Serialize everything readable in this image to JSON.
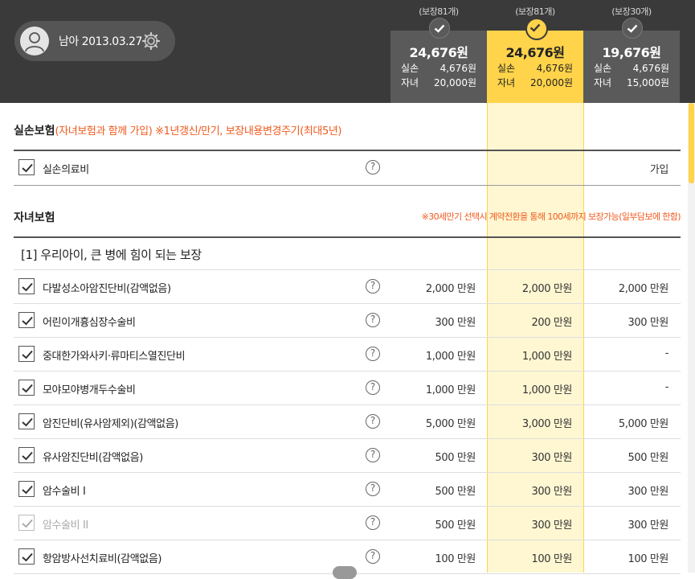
{
  "profile": {
    "text": "남아 2013.03.27"
  },
  "plans": [
    {
      "count": "(보장81개)",
      "price": "24,676원",
      "rows": [
        {
          "k": "실손",
          "v": "4,676원"
        },
        {
          "k": "자녀",
          "v": "20,000원"
        }
      ]
    },
    {
      "count": "(보장81개)",
      "price": "24,676원",
      "rows": [
        {
          "k": "실손",
          "v": "4,676원"
        },
        {
          "k": "자녀",
          "v": "20,000원"
        }
      ]
    },
    {
      "count": "(보장30개)",
      "price": "19,676원",
      "rows": [
        {
          "k": "실손",
          "v": "4,676원"
        },
        {
          "k": "자녀",
          "v": "15,000원"
        }
      ]
    }
  ],
  "section1": {
    "title": "실손보험",
    "note": "(자녀보험과 함께 가입) ※1년갱신/만기, 보장내용변경주기(최대5년)",
    "item": {
      "label": "실손의료비",
      "value": "가입"
    }
  },
  "section2": {
    "title": "자녀보험",
    "note": "※30세만기 선택시 계약전환을 통해 100세까지 보장가능(일부담보에 한함)",
    "group_title": "[1] 우리아이, 큰 병에 힘이 되는 보장",
    "items": [
      {
        "label": "다발성소아암진단비(감액없음)",
        "v1": "2,000 만원",
        "v2": "2,000 만원",
        "v3": "2,000 만원"
      },
      {
        "label": "어린이개흉심장수술비",
        "v1": "300 만원",
        "v2": "200 만원",
        "v3": "300 만원"
      },
      {
        "label": "중대한가와사키·류마티스열진단비",
        "v1": "1,000 만원",
        "v2": "1,000 만원",
        "v3": "-"
      },
      {
        "label": "모야모야병개두수술비",
        "v1": "1,000 만원",
        "v2": "1,000 만원",
        "v3": "-"
      },
      {
        "label": "암진단비(유사암제외)(감액없음)",
        "v1": "5,000 만원",
        "v2": "3,000 만원",
        "v3": "5,000 만원"
      },
      {
        "label": "유사암진단비(감액없음)",
        "v1": "500 만원",
        "v2": "300 만원",
        "v3": "500 만원"
      },
      {
        "label": "암수술비 I",
        "v1": "500 만원",
        "v2": "300 만원",
        "v3": "300 만원"
      },
      {
        "label": "암수술비 II",
        "v1": "500 만원",
        "v2": "300 만원",
        "v3": "300 만원"
      },
      {
        "label": "항암방사선치료비(감액없음)",
        "v1": "100 만원",
        "v2": "100 만원",
        "v3": "100 만원"
      }
    ]
  },
  "help_glyph": "?",
  "colors": {
    "header_bg": "#3a3a3a",
    "accent": "#ffd34a",
    "note": "#f05a1e"
  }
}
